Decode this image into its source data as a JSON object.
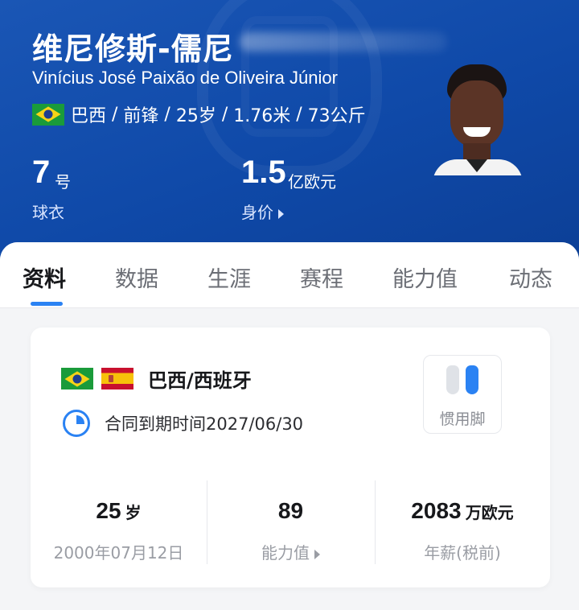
{
  "player": {
    "name_cn": "维尼修斯-儒尼",
    "name_en": "Vinícius José Paixão de Oliveira Júnior",
    "country": "巴西",
    "position": "前锋",
    "age": "25岁",
    "height": "1.76米",
    "weight": "73公斤",
    "separator": " / "
  },
  "header_stats": {
    "shirt_number": "7",
    "shirt_unit": "号",
    "shirt_label": "球衣",
    "value": "1.5",
    "value_unit": "亿欧元",
    "value_label": "身价"
  },
  "tabs": [
    {
      "label": "资料",
      "active": true
    },
    {
      "label": "数据"
    },
    {
      "label": "生涯"
    },
    {
      "label": "赛程"
    },
    {
      "label": "能力值"
    },
    {
      "label": "动态"
    }
  ],
  "profile": {
    "nationality": "巴西/西班牙",
    "contract": "合同到期时间2027/06/30",
    "foot_label": "惯用脚",
    "age_value": "25",
    "age_unit": "岁",
    "birth_date": "2000年07月12日",
    "rating_value": "89",
    "rating_label": "能力值",
    "salary_value": "2083",
    "salary_unit": "万欧元",
    "salary_label": "年薪(税前)"
  },
  "colors": {
    "header_blue": "#1450ae",
    "accent": "#2a82f3"
  },
  "icons": [
    "brazil-flag-icon",
    "spain-flag-icon",
    "clock-icon",
    "footprint-icon",
    "chevron-right-icon"
  ]
}
